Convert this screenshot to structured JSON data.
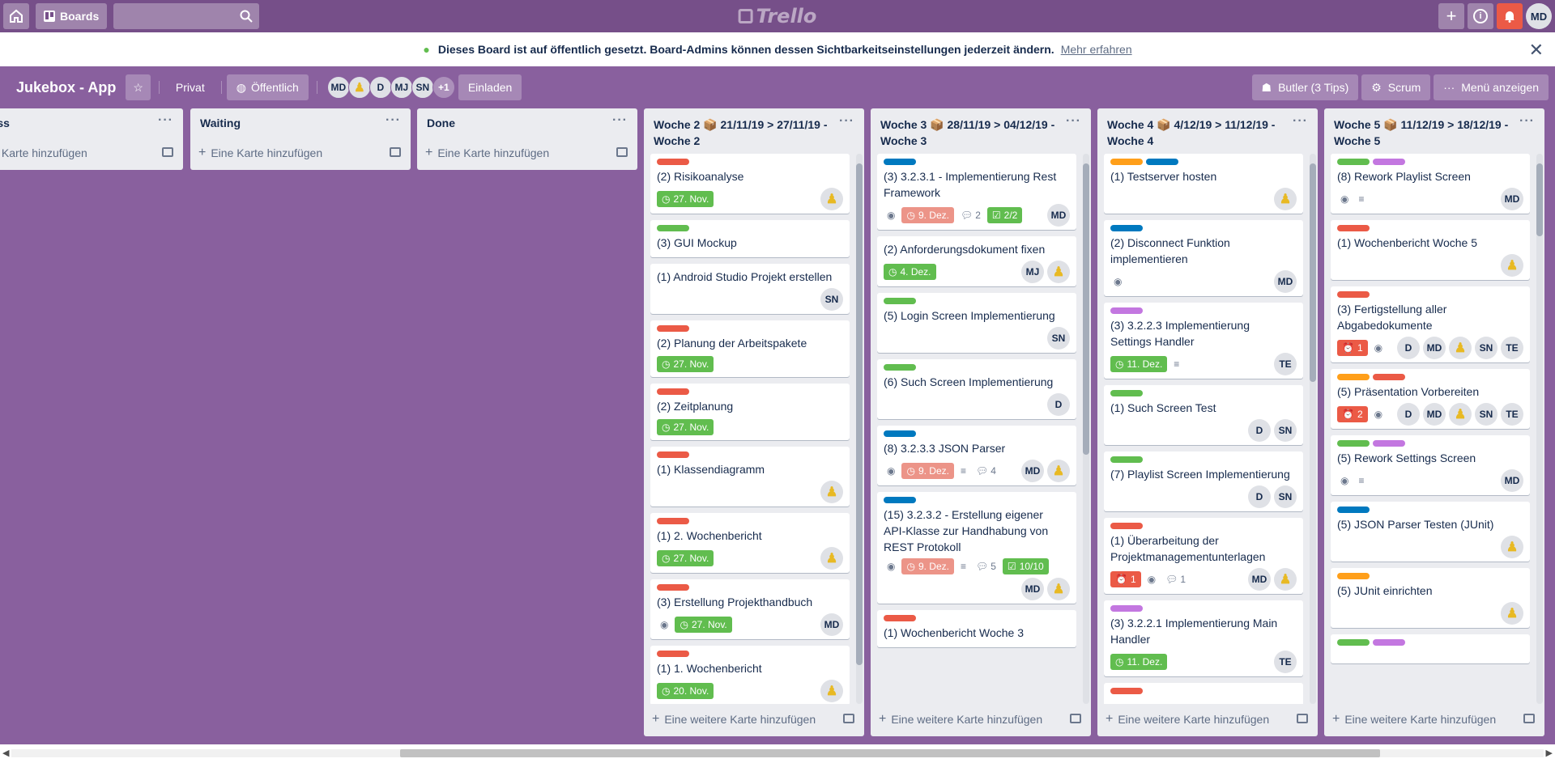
{
  "topbar": {
    "boards_label": "Boards",
    "logo": "Trello",
    "avatar": "MD"
  },
  "banner": {
    "text": "Dieses Board ist auf öffentlich gesetzt. Board-Admins können dessen Sichtbarkeitseinstellungen jederzeit ändern.",
    "link": "Mehr erfahren"
  },
  "board": {
    "title": "Jukebox - App",
    "privat": "Privat",
    "public": "Öffentlich",
    "members": [
      "MD",
      "",
      "D",
      "MJ",
      "SN",
      "+1"
    ],
    "invite": "Einladen",
    "butler": "Butler (3 Tips)",
    "scrum": "Scrum",
    "menu": "Menü anzeigen"
  },
  "colors": {
    "green": "#61bd4f",
    "red": "#eb5a46",
    "blue": "#0079bf",
    "purple": "#c377e0",
    "orange": "#ff9f1a"
  },
  "lists": [
    {
      "title": "ogress",
      "add": "ine Karte hinzufügen",
      "cards": []
    },
    {
      "title": "Waiting",
      "add": "Eine Karte hinzufügen",
      "cards": []
    },
    {
      "title": "Done",
      "add": "Eine Karte hinzufügen",
      "cards": []
    },
    {
      "title": "Woche 2 📦 21/11/19 > 27/11/19 - Woche 2",
      "add": "Eine weitere Karte hinzufügen",
      "cards": [
        {
          "labels": [
            "red"
          ],
          "title": "(2) Risikoanalyse",
          "due": "27. Nov.",
          "members": [
            "duck"
          ]
        },
        {
          "labels": [
            "green"
          ],
          "title": "(3) GUI Mockup",
          "members": []
        },
        {
          "labels": [],
          "title": "(1) Android Studio Projekt erstellen",
          "members": [
            "SN"
          ]
        },
        {
          "labels": [
            "red"
          ],
          "title": "(2) Planung der Arbeitspakete",
          "due": "27. Nov.",
          "members": []
        },
        {
          "labels": [
            "red"
          ],
          "title": "(2) Zeitplanung",
          "due": "27. Nov.",
          "members": []
        },
        {
          "labels": [
            "red"
          ],
          "title": "(1) Klassendiagramm",
          "members": [
            "duck"
          ]
        },
        {
          "labels": [
            "red"
          ],
          "title": "(1) 2. Wochenbericht",
          "due": "27. Nov.",
          "members": [
            "duck"
          ]
        },
        {
          "labels": [
            "red"
          ],
          "title": "(3) Erstellung Projekthandbuch",
          "watch": true,
          "due": "27. Nov.",
          "members": [
            "MD"
          ]
        },
        {
          "labels": [
            "red"
          ],
          "title": "(1) 1. Wochenbericht",
          "due": "20. Nov.",
          "members": [
            "duck"
          ]
        }
      ]
    },
    {
      "title": "Woche 3 📦 28/11/19 > 04/12/19 - Woche 3",
      "add": "Eine weitere Karte hinzufügen",
      "cards": [
        {
          "labels": [
            "blue"
          ],
          "title": "(3) 3.2.3.1 - Implementierung Rest Framework",
          "watch": true,
          "due": "9. Dez.",
          "dueRed": true,
          "comments": "2",
          "check": "2/2",
          "members": [
            "MD"
          ]
        },
        {
          "labels": [],
          "title": "(2) Anforderungsdokument fixen",
          "due": "4. Dez.",
          "members": [
            "MJ",
            "duck"
          ]
        },
        {
          "labels": [
            "green"
          ],
          "title": "(5) Login Screen Implementierung",
          "members": [
            "SN"
          ]
        },
        {
          "labels": [
            "green"
          ],
          "title": "(6) Such Screen Implementierung",
          "members": [
            "D"
          ]
        },
        {
          "labels": [
            "blue"
          ],
          "title": "(8) 3.2.3.3 JSON Parser",
          "watch": true,
          "due": "9. Dez.",
          "dueRed": true,
          "desc": true,
          "comments": "4",
          "members": [
            "MD",
            "duck"
          ]
        },
        {
          "labels": [
            "blue"
          ],
          "title": "(15) 3.2.3.2 - Erstellung eigener API-Klasse zur Handhabung von REST Protokoll",
          "watch": true,
          "due": "9. Dez.",
          "dueRed": true,
          "desc": true,
          "comments": "5",
          "check": "10/10",
          "members": [
            "MD",
            "duck"
          ]
        },
        {
          "labels": [
            "red"
          ],
          "title": "(1) Wochenbericht Woche 3",
          "members": []
        }
      ]
    },
    {
      "title": "Woche 4 📦 4/12/19 > 11/12/19 - Woche 4",
      "add": "Eine weitere Karte hinzufügen",
      "cards": [
        {
          "labels": [
            "orange",
            "blue"
          ],
          "title": "(1) Testserver hosten",
          "members": [
            "duck"
          ]
        },
        {
          "labels": [
            "blue"
          ],
          "title": "(2) Disconnect Funktion implementieren",
          "watch": true,
          "members": [
            "MD"
          ]
        },
        {
          "labels": [
            "purple"
          ],
          "title": "(3) 3.2.2.3 Implementierung Settings Handler",
          "due": "11. Dez.",
          "desc": true,
          "members": [
            "TE"
          ]
        },
        {
          "labels": [
            "green"
          ],
          "title": "(1) Such Screen Test",
          "members": [
            "D",
            "SN"
          ]
        },
        {
          "labels": [
            "green"
          ],
          "title": "(7) Playlist Screen Implementierung",
          "members": [
            "D",
            "SN"
          ]
        },
        {
          "labels": [
            "red"
          ],
          "title": "(1) Überarbeitung der Projektmanagementunterlagen",
          "alarm": "1",
          "watch": true,
          "comments": "1",
          "members": [
            "MD",
            "duck"
          ]
        },
        {
          "labels": [
            "purple"
          ],
          "title": "(3) 3.2.2.1 Implementierung Main Handler",
          "due": "11. Dez.",
          "members": [
            "TE"
          ]
        },
        {
          "labels": [
            "red"
          ],
          "title": "",
          "members": []
        }
      ]
    },
    {
      "title": "Woche 5 📦 11/12/19 > 18/12/19 - Woche 5",
      "add": "Eine weitere Karte hinzufügen",
      "cards": [
        {
          "labels": [
            "green",
            "purple"
          ],
          "title": "(8) Rework Playlist Screen",
          "watch": true,
          "desc": true,
          "members": [
            "MD"
          ]
        },
        {
          "labels": [
            "red"
          ],
          "title": "(1) Wochenbericht Woche 5",
          "members": [
            "duck"
          ]
        },
        {
          "labels": [
            "red"
          ],
          "title": "(3) Fertigstellung aller Abgabedokumente",
          "alarm": "1",
          "watch": true,
          "members": [
            "D",
            "MD",
            "duck",
            "SN",
            "TE"
          ]
        },
        {
          "labels": [
            "orange",
            "red"
          ],
          "title": "(5) Präsentation Vorbereiten",
          "alarm": "2",
          "watch": true,
          "members": [
            "D",
            "MD",
            "duck",
            "SN",
            "TE"
          ]
        },
        {
          "labels": [
            "green",
            "purple"
          ],
          "title": "(5) Rework Settings Screen",
          "watch": true,
          "desc": true,
          "members": [
            "MD"
          ]
        },
        {
          "labels": [
            "blue"
          ],
          "title": "(5) JSON Parser Testen (JUnit)",
          "members": [
            "duck"
          ]
        },
        {
          "labels": [
            "orange"
          ],
          "title": "(5) JUnit einrichten",
          "members": [
            "duck"
          ]
        },
        {
          "labels": [
            "green",
            "purple"
          ],
          "title": "",
          "members": []
        }
      ]
    }
  ]
}
